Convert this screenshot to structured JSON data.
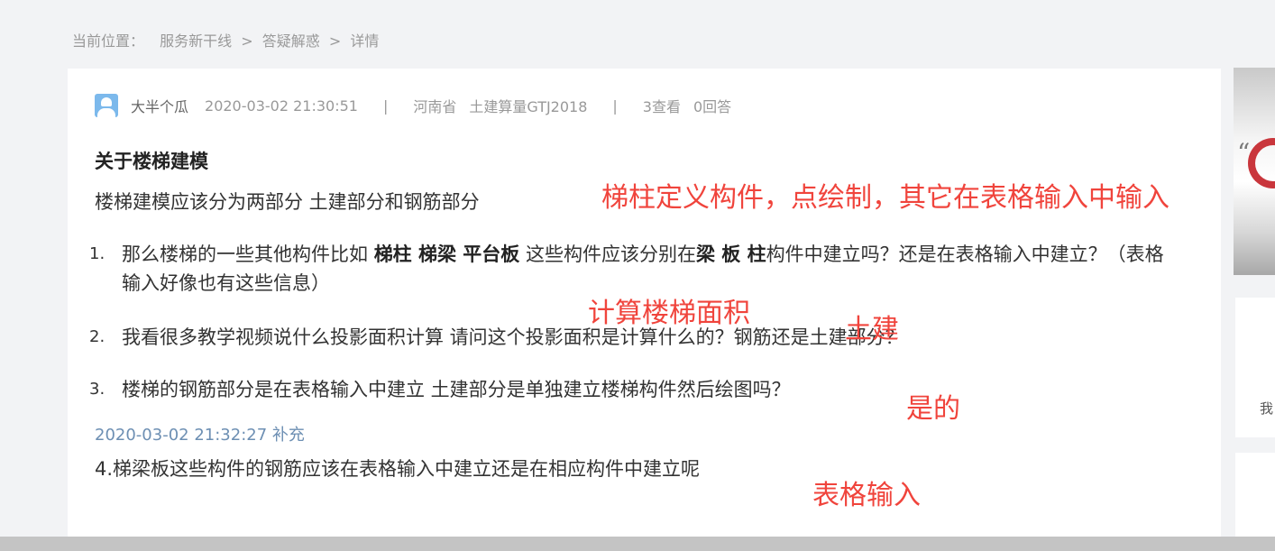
{
  "breadcrumb": {
    "label": "当前位置：",
    "items": [
      "服务新干线",
      "答疑解惑",
      "详情"
    ],
    "separator": ">"
  },
  "question": {
    "author": "大半个瓜",
    "posted_at": "2020-03-02 21:30:51",
    "region": "河南省",
    "software": "土建算量GTJ2018",
    "views": "3查看",
    "answers": "0回答",
    "title": "关于楼梯建模",
    "intro": "楼梯建模应该分为两部分 土建部分和钢筋部分",
    "items": [
      {
        "num": "1.",
        "p1": "那么楼梯的一些其他构件比如 ",
        "b1": "梯柱 梯梁 平台板",
        "p2": " 这些构件应该分别在",
        "b2": "梁 板 柱",
        "p3": "构件中建立吗？还是在表格输入中建立？（表格输入好像也有这些信息）"
      },
      {
        "num": "2.",
        "text": "我看很多教学视频说什么投影面积计算 请问这个投影面积是计算什么的？钢筋还是土建部分？"
      },
      {
        "num": "3.",
        "text": "楼梯的钢筋部分是在表格输入中建立 土建部分是单独建立楼梯构件然后绘图吗？"
      }
    ],
    "supplement_time": "2020-03-02 21:32:27 补充",
    "supplement_text": "4.梯梁板这些构件的钢筋应该在表格输入中建立还是在相应构件中建立呢"
  },
  "annotations": {
    "note_1": "梯柱定义构件，点绘制，其它在表格输入中输入",
    "note_2": "计算楼梯面积",
    "note_3": "土建",
    "note_4": "是的",
    "note_5": "表格输入",
    "color": "#f0443c"
  },
  "sidebar": {
    "banner_char": "“",
    "card_text": "我"
  }
}
